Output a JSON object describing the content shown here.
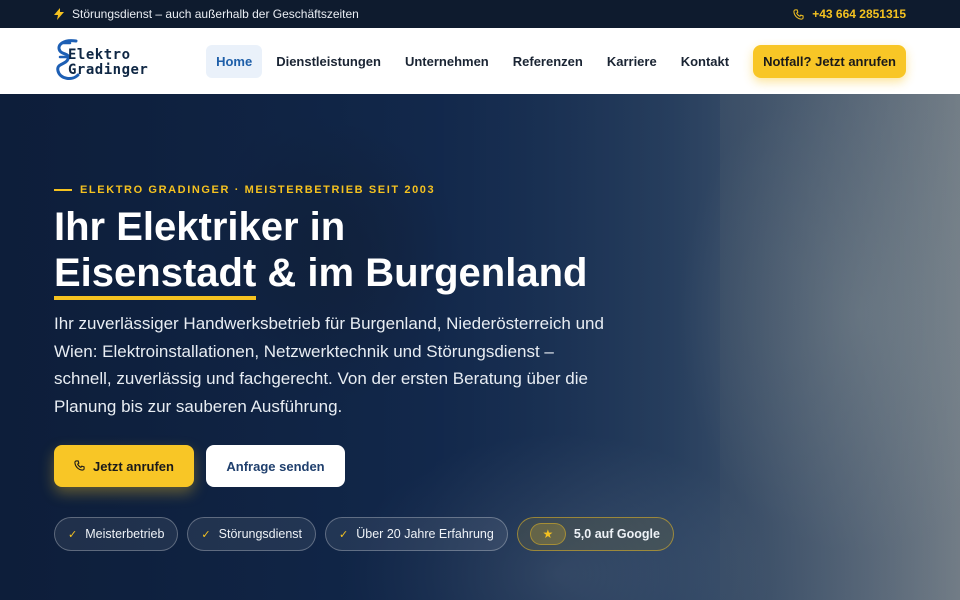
{
  "topbar": {
    "service_text": "Störungsdienst – auch außerhalb der Geschäftszeiten",
    "phone": "+43 664 2851315"
  },
  "nav": {
    "logo_line1": "Elektro",
    "logo_line2": "Gradinger",
    "items": [
      {
        "label": "Home",
        "active": true
      },
      {
        "label": "Dienstleistungen",
        "active": false
      },
      {
        "label": "Unternehmen",
        "active": false
      },
      {
        "label": "Referenzen",
        "active": false
      },
      {
        "label": "Karriere",
        "active": false
      },
      {
        "label": "Kontakt",
        "active": false
      }
    ],
    "cta": "Notfall? Jetzt anrufen"
  },
  "hero": {
    "kicker": "ELEKTRO GRADINGER · MEISTERBETRIEB SEIT 2003",
    "title_line1": "Ihr Elektriker in",
    "title_highlight": "Eisenstadt",
    "title_line2_rest": " & im Burgenland",
    "lead": "Ihr zuverlässiger Handwerksbetrieb für Burgenland, Niederösterreich und Wien: Elektroinstallationen, Netzwerktechnik und Störungsdienst – schnell, zuverlässig und fachgerecht. Von der ersten Beratung über die Planung bis zur sauberen Ausführung.",
    "primary_button": "Jetzt anrufen",
    "secondary_button": "Anfrage senden",
    "badges": [
      "Meisterbetrieb",
      "Störungsdienst",
      "Über 20 Jahre Erfahrung"
    ],
    "google_badge": "5,0 auf Google"
  },
  "colors": {
    "accent": "#f8c626",
    "navy": "#0f2744",
    "active_nav": "#1f5fa9"
  }
}
